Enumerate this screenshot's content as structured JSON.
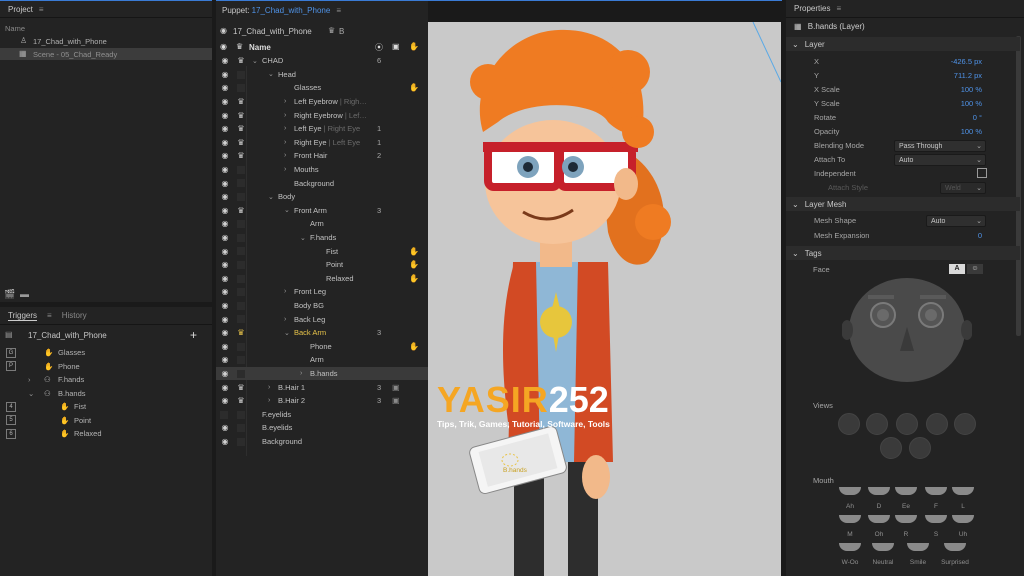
{
  "project": {
    "title": "Project",
    "column": "Name",
    "items": [
      "17_Chad_with_Phone",
      "Scene - 05_Chad_Ready"
    ]
  },
  "triggers": {
    "tab_triggers": "Triggers",
    "tab_history": "History",
    "puppet": "17_Chad_with_Phone",
    "add": "+",
    "rows": [
      {
        "key": "G",
        "label": "Glasses",
        "indent": 0
      },
      {
        "key": "P",
        "label": "Phone",
        "indent": 0
      },
      {
        "key": "",
        "label": "F.hands",
        "indent": 0,
        "chev": "›"
      },
      {
        "key": "",
        "label": "B.hands",
        "indent": 0,
        "chev": "⌄"
      },
      {
        "key": "4",
        "label": "Fist",
        "indent": 1
      },
      {
        "key": "5",
        "label": "Point",
        "indent": 1
      },
      {
        "key": "6",
        "label": "Relaxed",
        "indent": 1
      }
    ]
  },
  "puppet": {
    "title": "Puppet: ",
    "title_link": "17_Chad_with_Phone",
    "selector": "17_Chad_with_Phone",
    "selector_suffix": "B",
    "header_name": "Name",
    "layers": [
      {
        "name": "CHAD",
        "dim": "",
        "indent": 0,
        "chev": "⌄",
        "num": "6",
        "eye": true,
        "crown": true
      },
      {
        "name": "Head",
        "dim": "",
        "indent": 1,
        "chev": "⌄",
        "num": "",
        "eye": true,
        "crown": false
      },
      {
        "name": "Glasses",
        "dim": "",
        "indent": 2,
        "chev": "",
        "num": "",
        "eye": true,
        "crown": false,
        "hand": true
      },
      {
        "name": "Left Eyebrow",
        "dim": " | Righ…",
        "indent": 2,
        "chev": "›",
        "num": "",
        "eye": true,
        "crown": true
      },
      {
        "name": "Right Eyebrow",
        "dim": " | Lef…",
        "indent": 2,
        "chev": "›",
        "num": "",
        "eye": true,
        "crown": true
      },
      {
        "name": "Left Eye",
        "dim": " | Right Eye",
        "indent": 2,
        "chev": "›",
        "num": "1",
        "eye": true,
        "crown": true
      },
      {
        "name": "Right Eye",
        "dim": " | Left Eye",
        "indent": 2,
        "chev": "›",
        "num": "1",
        "eye": true,
        "crown": true
      },
      {
        "name": "Front Hair",
        "dim": "",
        "indent": 2,
        "chev": "›",
        "num": "2",
        "eye": true,
        "crown": true
      },
      {
        "name": "Mouths",
        "dim": "",
        "indent": 2,
        "chev": "›",
        "num": "",
        "eye": true,
        "crown": false
      },
      {
        "name": "Background",
        "dim": "",
        "indent": 2,
        "chev": "",
        "num": "",
        "eye": true,
        "crown": false
      },
      {
        "name": "Body",
        "dim": "",
        "indent": 1,
        "chev": "⌄",
        "num": "",
        "eye": true,
        "crown": false
      },
      {
        "name": "Front Arm",
        "dim": "",
        "indent": 2,
        "chev": "⌄",
        "num": "3",
        "eye": true,
        "crown": true
      },
      {
        "name": "Arm",
        "dim": "",
        "indent": 3,
        "chev": "",
        "num": "",
        "eye": true,
        "crown": false
      },
      {
        "name": "F.hands",
        "dim": "",
        "indent": 3,
        "chev": "⌄",
        "num": "",
        "eye": true,
        "crown": false
      },
      {
        "name": "Fist",
        "dim": "",
        "indent": 4,
        "chev": "",
        "num": "",
        "eye": true,
        "crown": false,
        "hand": true
      },
      {
        "name": "Point",
        "dim": "",
        "indent": 4,
        "chev": "",
        "num": "",
        "eye": true,
        "crown": false,
        "hand": true
      },
      {
        "name": "Relaxed",
        "dim": "",
        "indent": 4,
        "chev": "",
        "num": "",
        "eye": true,
        "crown": false,
        "hand": true
      },
      {
        "name": "Front Leg",
        "dim": "",
        "indent": 2,
        "chev": "›",
        "num": "",
        "eye": true,
        "crown": false
      },
      {
        "name": "Body BG",
        "dim": "",
        "indent": 2,
        "chev": "",
        "num": "",
        "eye": true,
        "crown": false
      },
      {
        "name": "Back Leg",
        "dim": "",
        "indent": 2,
        "chev": "›",
        "num": "",
        "eye": true,
        "crown": false
      },
      {
        "name": "Back Arm",
        "dim": "",
        "indent": 2,
        "chev": "⌄",
        "num": "3",
        "eye": true,
        "crown": true,
        "yellow": true
      },
      {
        "name": "Phone",
        "dim": "",
        "indent": 3,
        "chev": "",
        "num": "",
        "eye": true,
        "crown": false,
        "hand": true
      },
      {
        "name": "Arm",
        "dim": "",
        "indent": 3,
        "chev": "",
        "num": "",
        "eye": true,
        "crown": false
      },
      {
        "name": "B.hands",
        "dim": "",
        "indent": 3,
        "chev": "›",
        "num": "",
        "eye": true,
        "crown": false,
        "selected": true
      },
      {
        "name": "B.Hair 1",
        "dim": "",
        "indent": 1,
        "chev": "›",
        "num": "3",
        "eye": true,
        "crown": true,
        "cam": true
      },
      {
        "name": "B.Hair 2",
        "dim": "",
        "indent": 1,
        "chev": "›",
        "num": "3",
        "eye": true,
        "crown": true,
        "cam": true
      },
      {
        "name": "F.eyelids",
        "dim": "",
        "indent": 0,
        "chev": "",
        "num": "",
        "eye": false,
        "crown": false
      },
      {
        "name": "B.eyelids",
        "dim": "",
        "indent": 0,
        "chev": "",
        "num": "",
        "eye": true,
        "crown": false
      },
      {
        "name": "Background",
        "dim": "",
        "indent": 0,
        "chev": "",
        "num": "",
        "eye": true,
        "crown": false
      }
    ]
  },
  "canvas": {
    "handle_label": "B.hands",
    "watermark_main": "YASIR",
    "watermark_num": "252",
    "watermark_sub": "Tips, Trik, Games, Tutorial, Software, Tools"
  },
  "properties": {
    "title": "Properties",
    "layer_name": "B.hands (Layer)",
    "sections": {
      "layer": "Layer",
      "mesh": "Layer Mesh",
      "tags": "Tags"
    },
    "x_label": "X",
    "x_val": "-426.5 px",
    "y_label": "Y",
    "y_val": "711.2 px",
    "xs_label": "X Scale",
    "xs_val": "100 %",
    "ys_label": "Y Scale",
    "ys_val": "100 %",
    "rot_label": "Rotate",
    "rot_val": "0 °",
    "op_label": "Opacity",
    "op_val": "100 %",
    "blend_label": "Blending Mode",
    "blend_val": "Pass Through",
    "attach_label": "Attach To",
    "attach_val": "Auto",
    "indep_label": "Independent",
    "attstyle_label": "Attach Style",
    "attstyle_val": "Weld",
    "mesh_shape_label": "Mesh Shape",
    "mesh_shape_val": "Auto",
    "mesh_exp_label": "Mesh Expansion",
    "mesh_exp_val": "0",
    "face_label": "Face",
    "face_btn": "A",
    "views_label": "Views",
    "mouth_label": "Mouth",
    "mouth_row1": [
      "Ah",
      "D",
      "Ee",
      "F",
      "L"
    ],
    "mouth_row2": [
      "M",
      "Oh",
      "R",
      "S",
      "Uh"
    ],
    "mouth_row3": [
      "W-Oo",
      "Neutral",
      "Smile",
      "Surprised"
    ]
  },
  "colors": {
    "accent": "#4f93e8",
    "crown_active": "#e8c44a",
    "watermark": "#f5a623"
  }
}
